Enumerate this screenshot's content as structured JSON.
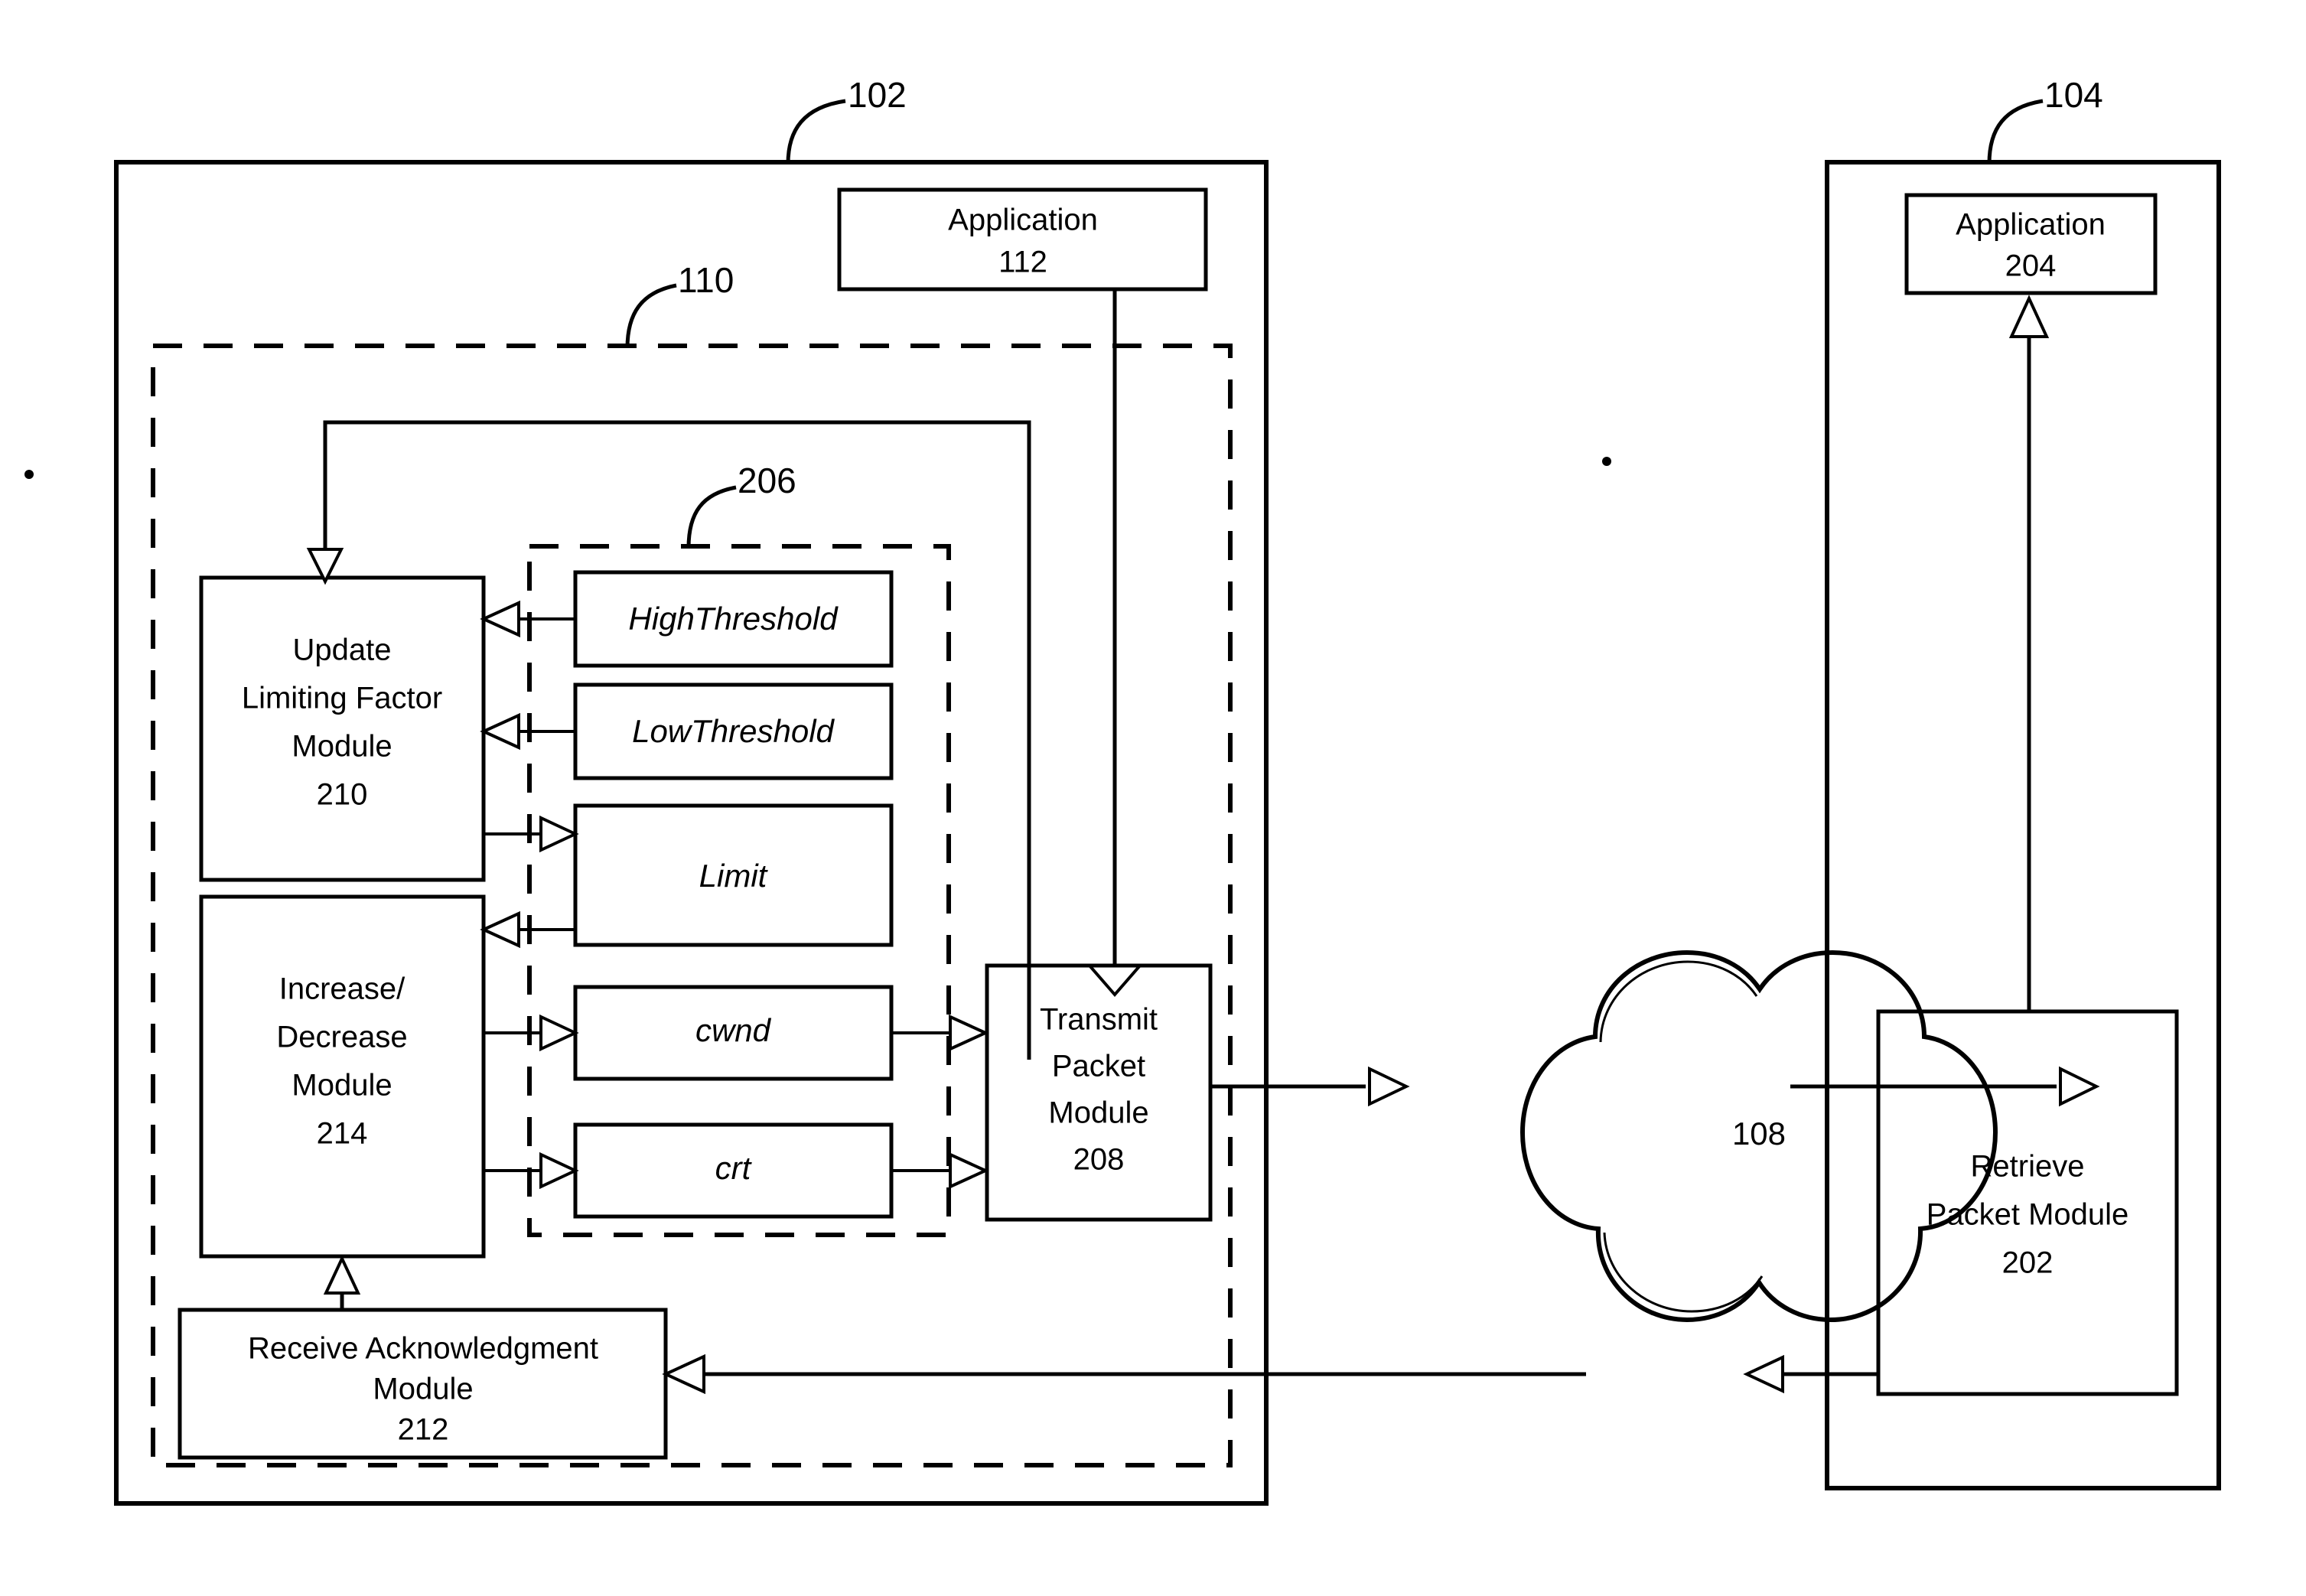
{
  "figure": {
    "type": "patent-block-diagram",
    "background": "#ffffff",
    "line_color": "#000000"
  },
  "reference_numerals": {
    "sender_device": "102",
    "receiver_device": "104",
    "protocol_stack": "110",
    "variable_group": "206",
    "network_cloud": "108"
  },
  "sender": {
    "application": {
      "name": "Application",
      "number": "112"
    },
    "update_limiting_factor_module": {
      "line1": "Update",
      "line2": "Limiting Factor",
      "line3": "Module",
      "number": "210"
    },
    "increase_decrease_module": {
      "line1": "Increase/",
      "line2": "Decrease",
      "line3": "Module",
      "number": "214"
    },
    "receive_acknowledgment_module": {
      "line1": "Receive Acknowledgment",
      "line2": "Module",
      "number": "212"
    },
    "transmit_packet_module": {
      "line1": "Transmit",
      "line2": "Packet",
      "line3": "Module",
      "number": "208"
    },
    "variables": [
      {
        "name": "HighThreshold"
      },
      {
        "name": "LowThreshold"
      },
      {
        "name": "Limit"
      },
      {
        "name": "cwnd"
      },
      {
        "name": "crt"
      }
    ]
  },
  "network": {
    "label": "108",
    "shape": "cloud"
  },
  "receiver": {
    "application": {
      "name": "Application",
      "number": "204"
    },
    "retrieve_packet_module": {
      "line1": "Retrieve",
      "line2": "Packet Module",
      "number": "202"
    }
  }
}
